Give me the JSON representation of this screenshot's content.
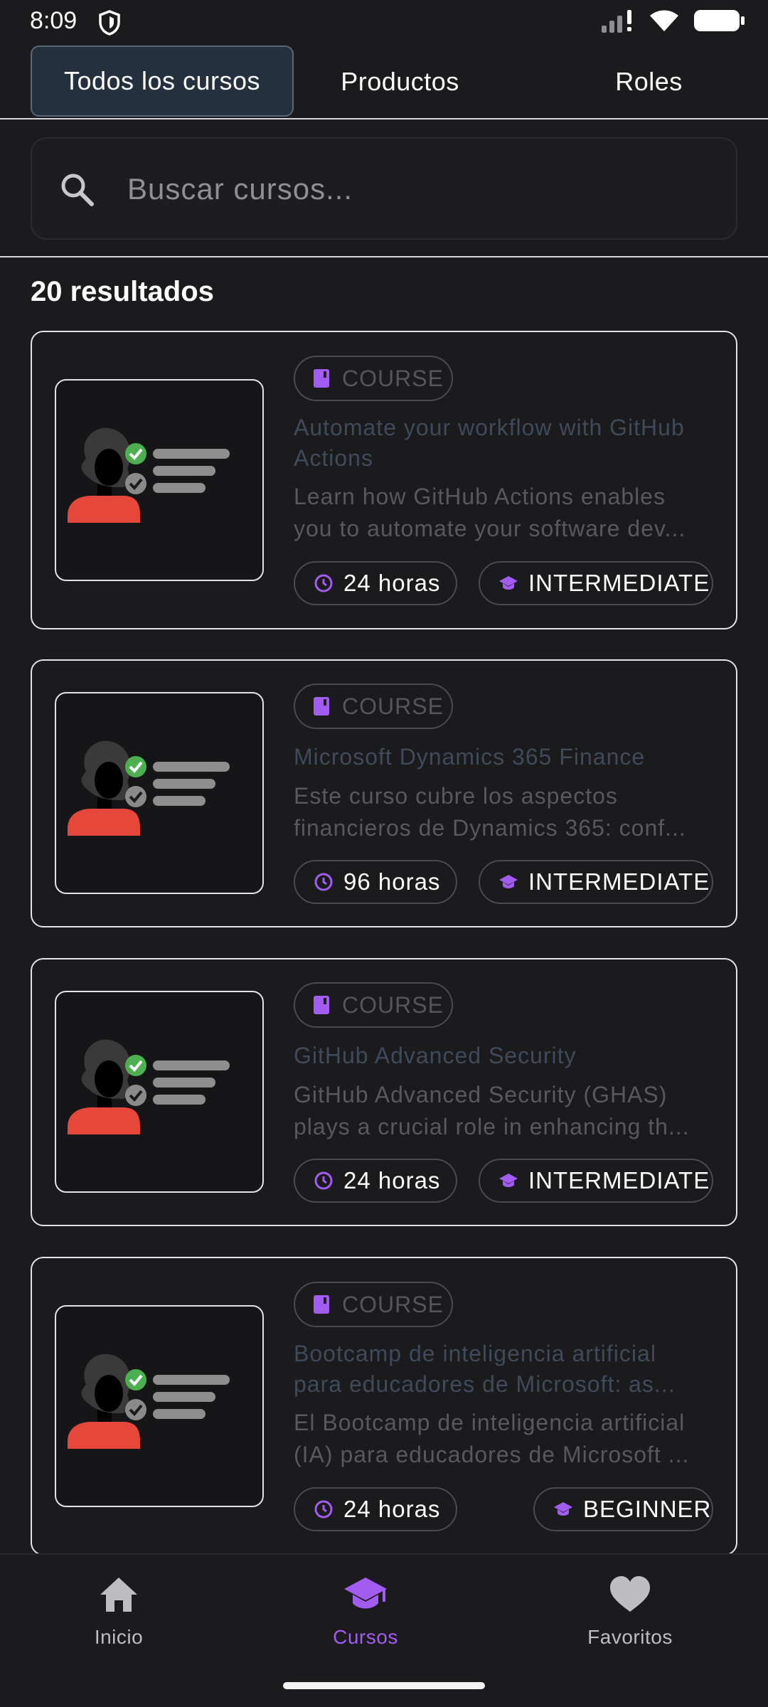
{
  "status_bar": {
    "time": "8:09"
  },
  "tabs": [
    {
      "label": "Todos los cursos",
      "active": true
    },
    {
      "label": "Productos",
      "active": false
    },
    {
      "label": "Roles",
      "active": false
    }
  ],
  "search": {
    "placeholder": "Buscar cursos..."
  },
  "results": {
    "count_label": "20 resultados"
  },
  "courses": [
    {
      "type": "COURSE",
      "title": "Automate your workflow with GitHub Actions",
      "desc_line1": "Learn how GitHub Actions enables",
      "desc_line2": "you to automate your software dev...",
      "duration": "24 horas",
      "level": "INTERMEDIATE"
    },
    {
      "type": "COURSE",
      "title": "Microsoft Dynamics 365 Finance",
      "desc_line1": "Este curso cubre los aspectos",
      "desc_line2": "financieros de Dynamics 365: conf...",
      "duration": "96 horas",
      "level": "INTERMEDIATE"
    },
    {
      "type": "COURSE",
      "title": "GitHub Advanced Security",
      "desc_line1": "GitHub Advanced Security (GHAS)",
      "desc_line2": "plays a crucial role in enhancing th...",
      "duration": "24 horas",
      "level": "INTERMEDIATE"
    },
    {
      "type": "COURSE",
      "title_line1": "Bootcamp de inteligencia artificial",
      "title_line2": "para educadores de Microsoft: as...",
      "desc_line1": "El Bootcamp de inteligencia artificial",
      "desc_line2": "(IA) para educadores de Microsoft ...",
      "duration": "24 horas",
      "level": "BEGINNER"
    }
  ],
  "bottom_nav": [
    {
      "label": "Inicio",
      "icon": "home-icon",
      "active": false
    },
    {
      "label": "Cursos",
      "icon": "graduation-cap-icon",
      "active": true
    },
    {
      "label": "Favoritos",
      "icon": "heart-icon",
      "active": false
    }
  ],
  "colors": {
    "background": "#1b1b1d",
    "accent_purple": "#a35cf0",
    "active_tab_bg": "#25303f",
    "check_green": "#4caf50",
    "avatar_red": "#e5483b"
  }
}
